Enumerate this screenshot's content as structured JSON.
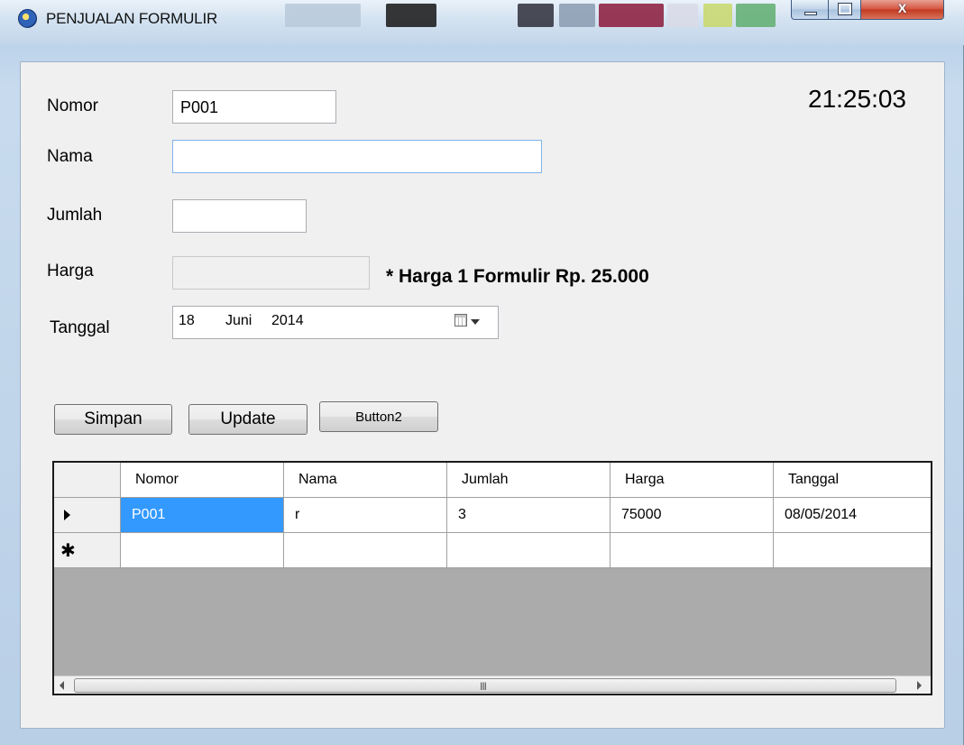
{
  "window": {
    "title": "PENJUALAN FORMULIR",
    "caption_buttons": {
      "minimize": "minimize-icon",
      "maximize": "maximize-icon",
      "close_label": "X"
    }
  },
  "form": {
    "clock": "21:25:03",
    "labels": {
      "nomor": "Nomor",
      "nama": "Nama",
      "jumlah": "Jumlah",
      "harga": "Harga",
      "tanggal": "Tanggal"
    },
    "values": {
      "nomor": "P001",
      "nama": "",
      "jumlah": "",
      "harga": ""
    },
    "price_note": "* Harga 1 Formulir Rp. 25.000",
    "date": {
      "day": "18",
      "month": "Juni",
      "year": "2014"
    }
  },
  "buttons": {
    "simpan": "Simpan",
    "update": "Update",
    "button2": "Button2"
  },
  "grid": {
    "columns": [
      "Nomor",
      "Nama",
      "Jumlah",
      "Harga",
      "Tanggal"
    ],
    "rows": [
      {
        "nomor": "P001",
        "nama": "r",
        "jumlah": "3",
        "harga": "75000",
        "tanggal": "08/05/2014"
      }
    ],
    "new_row_marker": "✱",
    "scroll_grip": "III"
  }
}
